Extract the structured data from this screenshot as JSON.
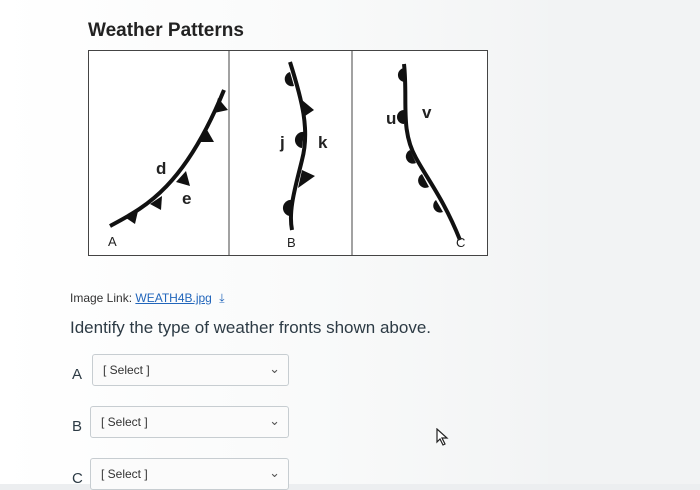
{
  "question_title": "Weather Patterns",
  "diagram": {
    "panel_labels": [
      "A",
      "B",
      "C"
    ],
    "front_labels": [
      "d",
      "e",
      "j",
      "k",
      "u",
      "v"
    ]
  },
  "image_link": {
    "prefix": "Image Link:",
    "link_text": "WEATH4B.jpg",
    "download_icon": "download-icon"
  },
  "question_text": "Identify the type of weather fronts shown above.",
  "answers": [
    {
      "label": "A",
      "value": "[ Select ]"
    },
    {
      "label": "B",
      "value": "[ Select ]"
    },
    {
      "label": "C",
      "value": "[ Select ]"
    }
  ],
  "icons": {
    "dropdown": "chevron-down-icon",
    "pointer": "mouse-cursor-icon"
  }
}
